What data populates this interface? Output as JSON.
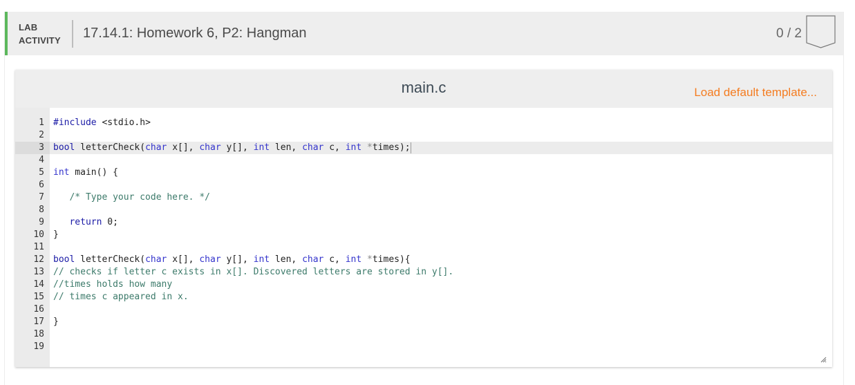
{
  "activity": {
    "type_line1": "LAB",
    "type_line2": "ACTIVITY",
    "title": "17.14.1: Homework 6, P2: Hangman",
    "score": "0 / 2",
    "accent_color": "#5cb85c",
    "badge_icon": "score-badge-icon"
  },
  "editor": {
    "filename": "main.c",
    "load_template_label": "Load default template...",
    "load_template_color": "#f47c20",
    "active_line": 3,
    "lines": [
      {
        "n": "1",
        "text": "#include <stdio.h>"
      },
      {
        "n": "2",
        "text": ""
      },
      {
        "n": "3",
        "text": "bool letterCheck(char x[], char y[], int len, char c, int *times);"
      },
      {
        "n": "4",
        "text": ""
      },
      {
        "n": "5",
        "text": "int main() {"
      },
      {
        "n": "6",
        "text": ""
      },
      {
        "n": "7",
        "text": "   /* Type your code here. */"
      },
      {
        "n": "8",
        "text": ""
      },
      {
        "n": "9",
        "text": "   return 0;"
      },
      {
        "n": "10",
        "text": "}"
      },
      {
        "n": "11",
        "text": ""
      },
      {
        "n": "12",
        "text": "bool letterCheck(char x[], char y[], int len, char c, int *times){"
      },
      {
        "n": "13",
        "text": "// checks if letter c exists in x[]. Discovered letters are stored in y[]."
      },
      {
        "n": "14",
        "text": "//times holds how many"
      },
      {
        "n": "15",
        "text": "// times c appeared in x."
      },
      {
        "n": "16",
        "text": ""
      },
      {
        "n": "17",
        "text": "}"
      },
      {
        "n": "18",
        "text": ""
      },
      {
        "n": "19",
        "text": ""
      }
    ]
  }
}
